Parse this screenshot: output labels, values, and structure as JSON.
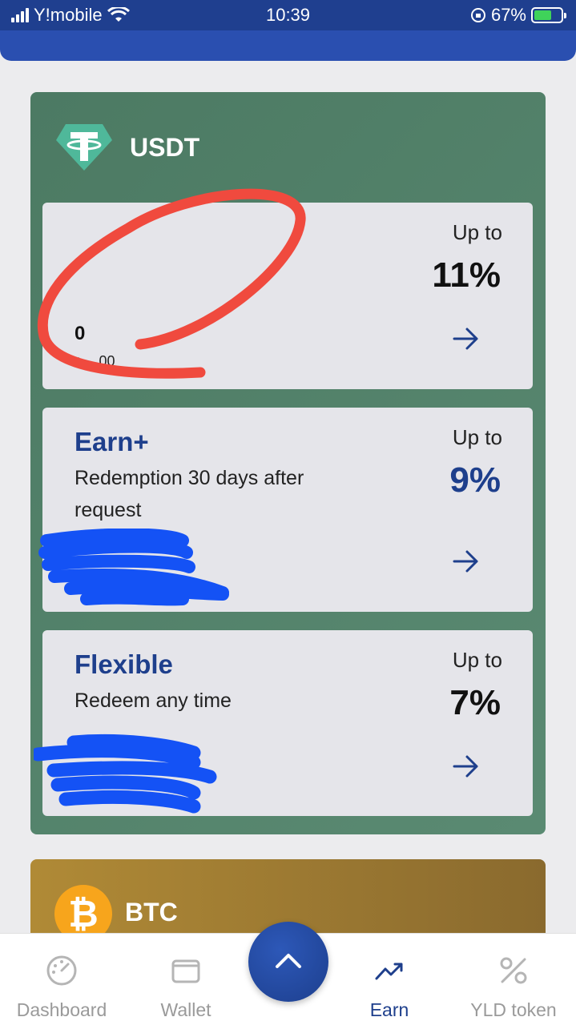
{
  "status_bar": {
    "carrier": "Y!mobile",
    "time": "10:39",
    "battery": "67%",
    "battery_level": 0.67
  },
  "usdt": {
    "name": "USDT",
    "icon": "tether-icon",
    "cards": [
      {
        "balance": "0",
        "balance_sub": "+ ...00",
        "up_to_label": "Up to",
        "rate": "11%"
      },
      {
        "title": "Earn+",
        "description": "Redemption 30 days after request",
        "up_to_label": "Up to",
        "rate": "9%"
      },
      {
        "title": "Flexible",
        "description": "Redeem any time",
        "up_to_label": "Up to",
        "rate": "7%"
      }
    ]
  },
  "btc": {
    "name": "BTC",
    "icon": "bitcoin-icon",
    "symbol": "₿"
  },
  "bottom_nav": {
    "items": [
      {
        "label": "Dashboard",
        "icon": "dashboard-gauge-icon",
        "active": false
      },
      {
        "label": "Wallet",
        "icon": "wallet-icon",
        "active": false
      },
      {
        "label": "Earn",
        "icon": "trending-up-icon",
        "active": true
      },
      {
        "label": "YLD token",
        "icon": "percent-icon",
        "active": false
      }
    ],
    "fab_icon": "chevron-up-icon"
  },
  "colors": {
    "primary": "#1e3f8c",
    "usdt_card_bg": "#4c7a63",
    "btc_card_bg": "#b08a36",
    "redaction_red": "#f04a3e",
    "redaction_blue": "#1452f5"
  }
}
